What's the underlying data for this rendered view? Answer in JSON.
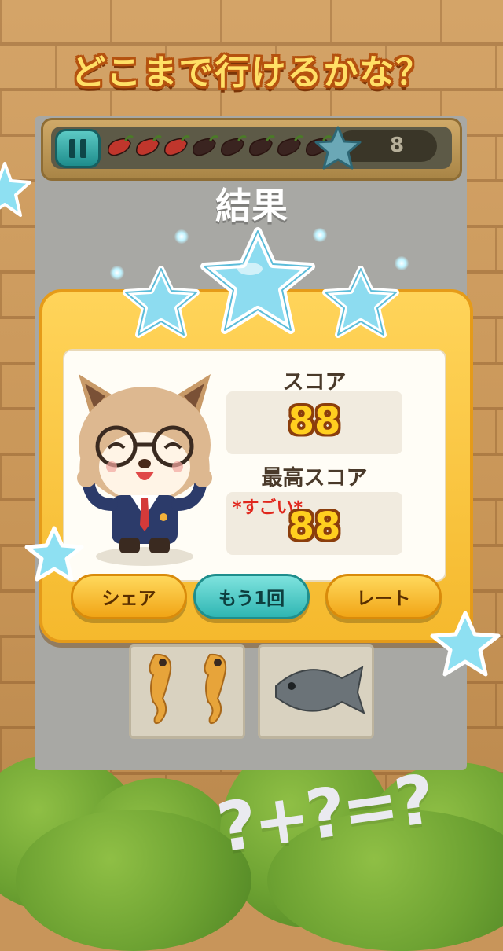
{
  "banner": {
    "title": "どこまで行けるかな？"
  },
  "hud": {
    "peppers_total": 8,
    "peppers_active": 3,
    "star_count": "8"
  },
  "result": {
    "title": "結果",
    "stars_earned": 3
  },
  "score": {
    "label": "スコア",
    "value": "88"
  },
  "best": {
    "label": "最高スコア",
    "value": "88",
    "badge": "*すごい*"
  },
  "buttons": {
    "share": "シェア",
    "retry": "もう1回",
    "rate": "レート"
  },
  "footer": {
    "puzzle": "?+?=?"
  },
  "colors": {
    "star": "#7fd6ee",
    "pepper_active": "#c0362c",
    "pepper_inactive": "#3a2420",
    "accent_orange": "#f5b92d",
    "accent_teal": "#2fb6b3"
  }
}
